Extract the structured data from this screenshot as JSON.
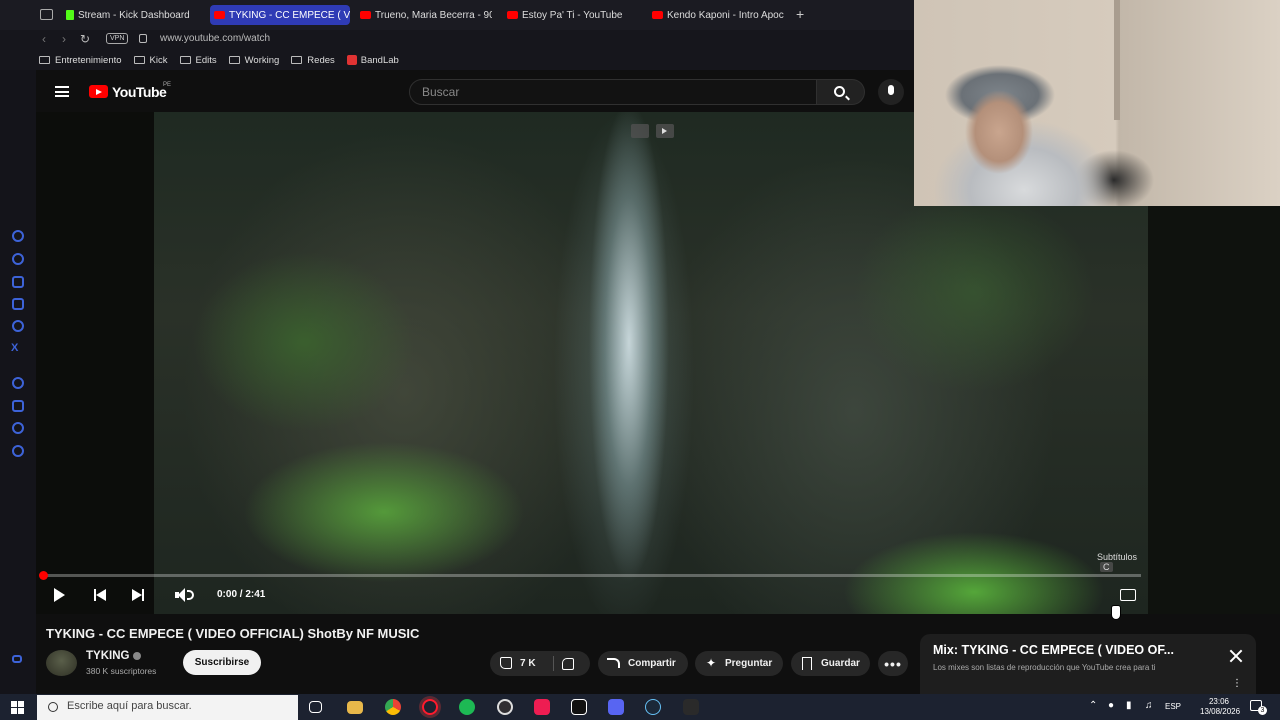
{
  "browser": {
    "tabs": [
      {
        "label": "Stream - Kick Dashboard",
        "favicon": "kick-icon",
        "active": false
      },
      {
        "label": "TYKING - CC EMPECE ( VI",
        "favicon": "youtube-icon",
        "active": true
      },
      {
        "label": "Trueno, Maria Becerra - 90",
        "favicon": "youtube-icon",
        "active": false
      },
      {
        "label": "Estoy Pa' Ti - YouTube",
        "favicon": "youtube-icon",
        "active": false
      },
      {
        "label": "Kendo Kaponi - Intro Apoc",
        "favicon": "youtube-icon",
        "active": false
      }
    ],
    "new_tab_glyph": "+",
    "vpn_label": "VPN",
    "url": "www.youtube.com/watch",
    "bookmarks": [
      "Entretenimiento",
      "Kick",
      "Edits",
      "Working",
      "Redes",
      "BandLab"
    ],
    "sidebar_icons": [
      "messenger-icon",
      "whatsapp-icon",
      "discord-icon",
      "instagram-icon",
      "tiktok-icon",
      "x-icon",
      "history-icon",
      "downloads-icon",
      "extensions-icon",
      "settings-icon"
    ],
    "accent_color": "#2f3bb5"
  },
  "youtube": {
    "logo_text": "YouTube",
    "country_code": "PE",
    "search_placeholder": "Buscar",
    "brand_color": "#ff0000"
  },
  "player": {
    "current_time": "0:00",
    "duration": "2:41",
    "time_display": "0:00 / 2:41",
    "progress_fraction": 0.0,
    "subtitles_hint": "Subtítulos",
    "subtitles_key": "C",
    "controls": [
      "play-icon",
      "previous-icon",
      "next-icon",
      "volume-icon",
      "captions-icon",
      "settings-icon",
      "theater-icon",
      "fullscreen-icon"
    ]
  },
  "video": {
    "title": "TYKING - CC EMPECE ( VIDEO OFFICIAL) ShotBy NF MUSIC",
    "channel_name": "TYKING",
    "subscribers": "380 K suscriptores",
    "subscribe_label": "Suscribirse",
    "like_count": "7 K",
    "share_label": "Compartir",
    "ask_label": "Preguntar",
    "save_label": "Guardar",
    "more_label": "•••"
  },
  "mix": {
    "title": "Mix: TYKING - CC EMPECE ( VIDEO OF...",
    "description": "Los mixes son listas de reproducción que YouTube crea para ti"
  },
  "taskbar": {
    "search_placeholder": "Escribe aquí para buscar.",
    "apps": [
      "task-view-icon",
      "file-explorer-icon",
      "chrome-icon",
      "opera-icon",
      "spotify-icon",
      "obs-icon",
      "tiktok-icon",
      "capcut-icon",
      "discord-icon",
      "steam-icon",
      "epic-games-icon"
    ],
    "language": "ESP",
    "time": "23:06",
    "date": "13/08/2026",
    "notification_count": "3"
  }
}
